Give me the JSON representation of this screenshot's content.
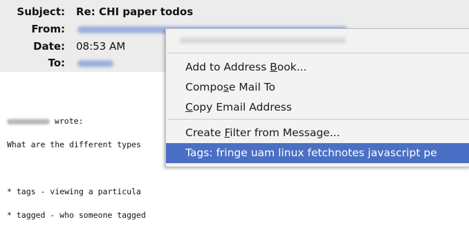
{
  "headers": {
    "subject_label": "Subject:",
    "subject_value": "Re: CHI paper todos",
    "from_label": "From:",
    "date_label": "Date:",
    "date_value": "08:53 AM",
    "to_label": "To:"
  },
  "body": {
    "line1_suffix": " wrote:",
    "line2": "What are the different types",
    "line3": "* tags - viewing a particula",
    "line4": "* tagged - who someone tagged"
  },
  "context_menu": {
    "items": [
      {
        "pre": "Add to Address ",
        "mnemonic": "B",
        "post": "ook..."
      },
      {
        "pre": "Compo",
        "mnemonic": "s",
        "post": "e Mail To"
      },
      {
        "pre": "",
        "mnemonic": "C",
        "post": "opy Email Address"
      },
      {
        "pre": "Create ",
        "mnemonic": "F",
        "post": "ilter from Message..."
      },
      {
        "label": "Tags: fringe uam linux fetchnotes javascript pe"
      }
    ]
  },
  "colors": {
    "header_bg": "#ececec",
    "highlight": "#4a6fc4",
    "link_blur": "#9bb0dd"
  }
}
